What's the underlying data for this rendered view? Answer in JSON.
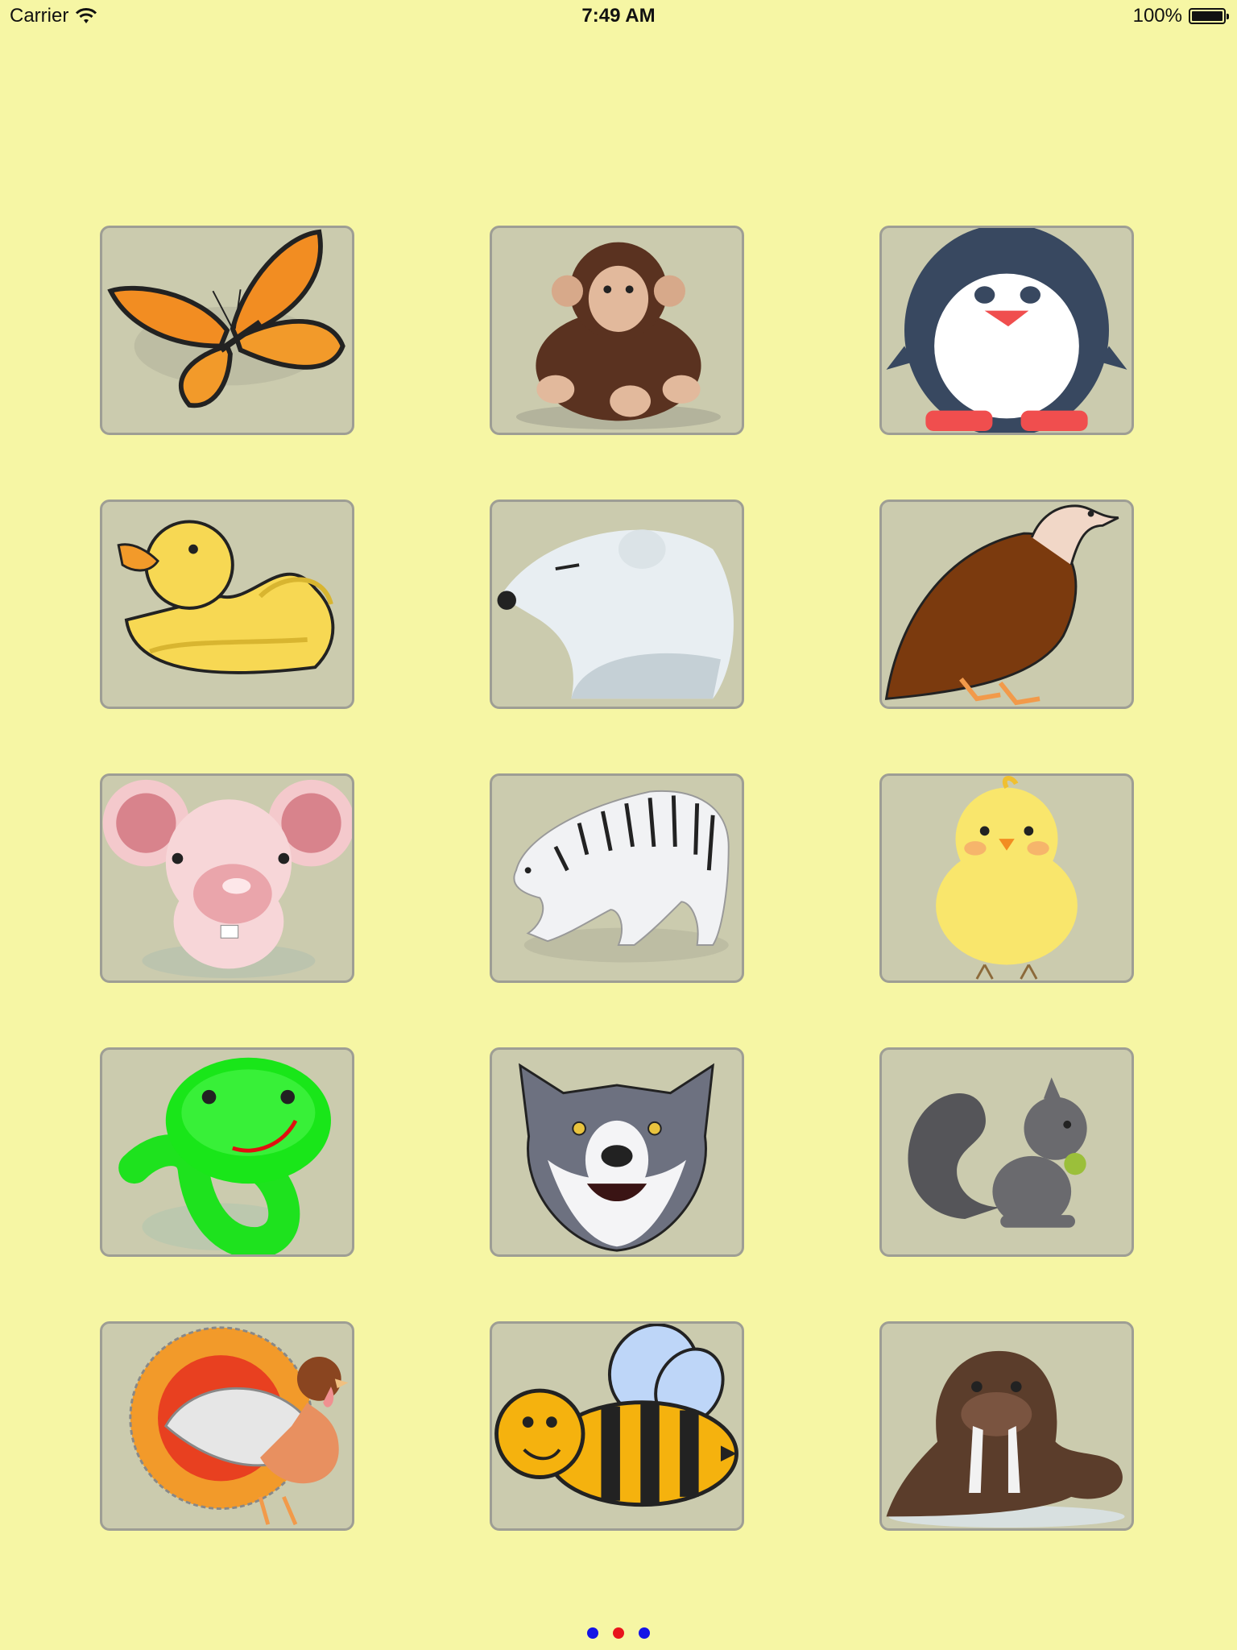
{
  "status_bar": {
    "carrier": "Carrier",
    "time": "7:49 AM",
    "battery": "100%",
    "battery_level": 1.0
  },
  "tiles": [
    {
      "animal": "butterfly",
      "icon": "butterfly-icon"
    },
    {
      "animal": "monkey",
      "icon": "monkey-icon"
    },
    {
      "animal": "penguin",
      "icon": "penguin-icon"
    },
    {
      "animal": "duck",
      "icon": "duck-icon"
    },
    {
      "animal": "polar bear",
      "icon": "polar-bear-icon"
    },
    {
      "animal": "vulture",
      "icon": "vulture-icon"
    },
    {
      "animal": "mouse",
      "icon": "mouse-icon"
    },
    {
      "animal": "tiger",
      "icon": "tiger-icon"
    },
    {
      "animal": "chick",
      "icon": "chick-icon"
    },
    {
      "animal": "snake",
      "icon": "snake-icon"
    },
    {
      "animal": "wolf",
      "icon": "wolf-icon"
    },
    {
      "animal": "squirrel",
      "icon": "squirrel-icon"
    },
    {
      "animal": "turkey",
      "icon": "turkey-icon"
    },
    {
      "animal": "bee",
      "icon": "bee-icon"
    },
    {
      "animal": "walrus",
      "icon": "walrus-icon"
    }
  ],
  "pager": {
    "page_count": 3,
    "current_page": 2,
    "active_color": "#e8141b",
    "inactive_color": "#1414e6"
  },
  "colors": {
    "background": "#f6f6a4",
    "tile": "#cbcbae",
    "tile_border": "#9e9e94"
  }
}
